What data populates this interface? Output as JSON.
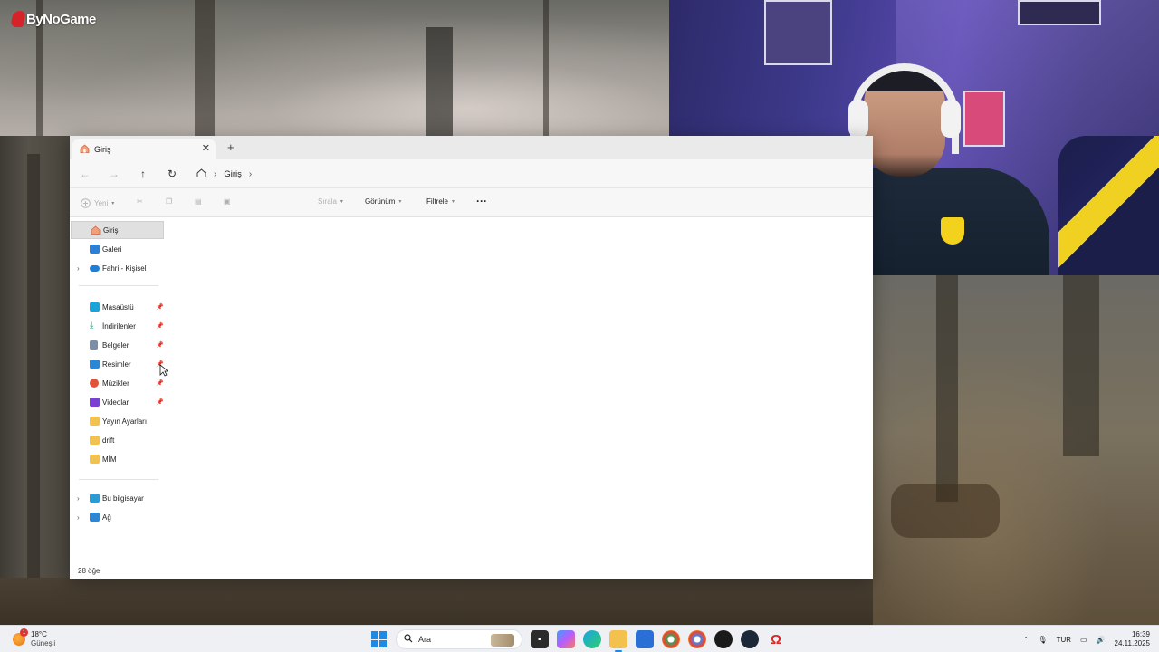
{
  "overlay": {
    "logo_text": "ByNoGame"
  },
  "explorer": {
    "tab": {
      "label": "Giriş",
      "icon": "home-icon"
    },
    "breadcrumb": {
      "current": "Giriş"
    },
    "toolbar": {
      "new_label": "Yeni",
      "sort_label": "Sırala",
      "view_label": "Görünüm",
      "filter_label": "Filtrele",
      "more_label": "···"
    },
    "sidebar": {
      "top": [
        {
          "label": "Giriş",
          "icon": "home-icon",
          "color": "#e8704a",
          "selected": true
        },
        {
          "label": "Galeri",
          "icon": "gallery-icon",
          "color": "#2b7fd4"
        },
        {
          "label": "Fahri - Kişisel",
          "icon": "onedrive-cloud-icon",
          "color": "#1e7fd9",
          "expandable": true
        }
      ],
      "pinned": [
        {
          "label": "Masaüstü",
          "icon": "desktop-icon",
          "color": "#1aa3d8"
        },
        {
          "label": "İndirilenler",
          "icon": "download-icon",
          "color": "#2aa36b"
        },
        {
          "label": "Belgeler",
          "icon": "documents-icon",
          "color": "#7c8ea6"
        },
        {
          "label": "Resimler",
          "icon": "pictures-icon",
          "color": "#2b86d6"
        },
        {
          "label": "Müzikler",
          "icon": "music-icon",
          "color": "#e0553a"
        },
        {
          "label": "Videolar",
          "icon": "videos-icon",
          "color": "#7b3fd4"
        },
        {
          "label": "Yayın Ayarları",
          "icon": "folder-icon",
          "color": "#f2c14e"
        },
        {
          "label": "drift",
          "icon": "folder-icon",
          "color": "#f2c14e"
        },
        {
          "label": "MİM",
          "icon": "folder-icon",
          "color": "#f2c14e"
        }
      ],
      "bottom": [
        {
          "label": "Bu bilgisayar",
          "icon": "this-pc-icon",
          "color": "#2b9bd4"
        },
        {
          "label": "Ağ",
          "icon": "network-icon",
          "color": "#2b86d6"
        }
      ]
    },
    "status": {
      "item_count": "28 öğe"
    }
  },
  "taskbar": {
    "weather": {
      "temp": "18°C",
      "desc": "Güneşli",
      "badge": "1"
    },
    "search_placeholder": "Ara",
    "tray": {
      "language": "TUR",
      "time": "16:39",
      "date": "24.11.2025"
    }
  },
  "colors": {
    "accent": "#1e8ae6",
    "selected_bg": "#e0e0e0"
  }
}
